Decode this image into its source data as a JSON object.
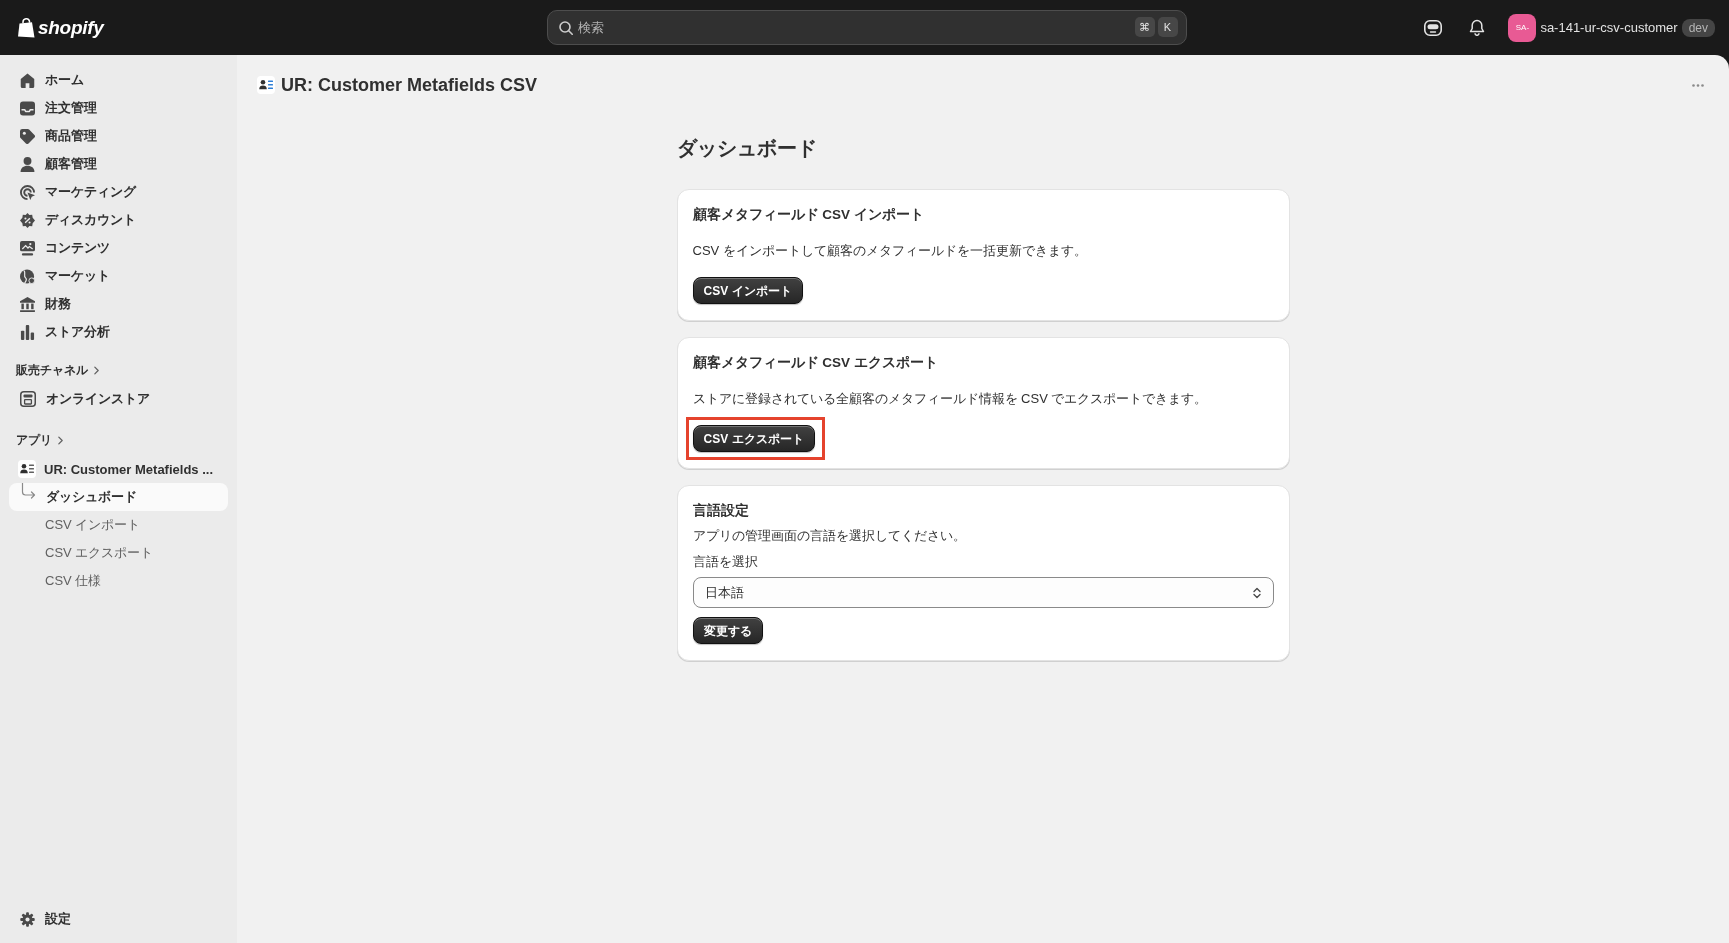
{
  "top_bar": {
    "logo": "shopify",
    "search": {
      "placeholder": "検索",
      "shortcut": [
        "⌘",
        "K"
      ]
    },
    "store": {
      "avatar": "SA-",
      "name": "sa-141-ur-csv-customer",
      "badge": "dev"
    }
  },
  "sidebar": {
    "items": [
      {
        "label": "ホーム",
        "selected": false
      },
      {
        "label": "注文管理",
        "selected": false
      },
      {
        "label": "商品管理",
        "selected": false
      },
      {
        "label": "顧客管理",
        "selected": false
      },
      {
        "label": "マーケティング",
        "selected": false
      },
      {
        "label": "ディスカウント",
        "selected": false
      },
      {
        "label": "コンテンツ",
        "selected": false
      },
      {
        "label": "マーケット",
        "selected": false
      },
      {
        "label": "財務",
        "selected": false
      },
      {
        "label": "ストア分析",
        "selected": false
      }
    ],
    "sales_channels": {
      "heading": "販売チャネル",
      "items": [
        {
          "label": "オンラインストア",
          "selected": false
        }
      ]
    },
    "apps": {
      "heading": "アプリ",
      "items": [
        {
          "label": "UR: Customer Metafields ...",
          "selected": false,
          "expanded": true,
          "children": [
            {
              "label": "ダッシュボード",
              "selected": true
            },
            {
              "label": "CSV インポート",
              "selected": false
            },
            {
              "label": "CSV エクスポート",
              "selected": false
            },
            {
              "label": "CSV 仕様",
              "selected": false
            }
          ]
        }
      ]
    },
    "settings": {
      "label": "設定",
      "selected": false
    }
  },
  "page_header": {
    "title": "UR: Customer Metafields CSV"
  },
  "main": {
    "heading": "ダッシュボード",
    "cards": [
      {
        "kind": "action",
        "title": "顧客メタフィールド CSV インポート",
        "description": "CSV をインポートして顧客のメタフィールドを一括更新できます。",
        "button": {
          "label": "CSV インポート",
          "highlighted": false
        }
      },
      {
        "kind": "action",
        "title": "顧客メタフィールド CSV エクスポート",
        "description": "ストアに登録されている全顧客のメタフィールド情報を CSV でエクスポートできます。",
        "button": {
          "label": "CSV エクスポート",
          "highlighted": true
        }
      },
      {
        "kind": "form",
        "title": "言語設定",
        "description": "アプリの管理画面の言語を選択してください。",
        "select": {
          "label": "言語を選択",
          "value": "日本語"
        },
        "button": {
          "label": "変更する",
          "highlighted": false
        }
      }
    ]
  }
}
